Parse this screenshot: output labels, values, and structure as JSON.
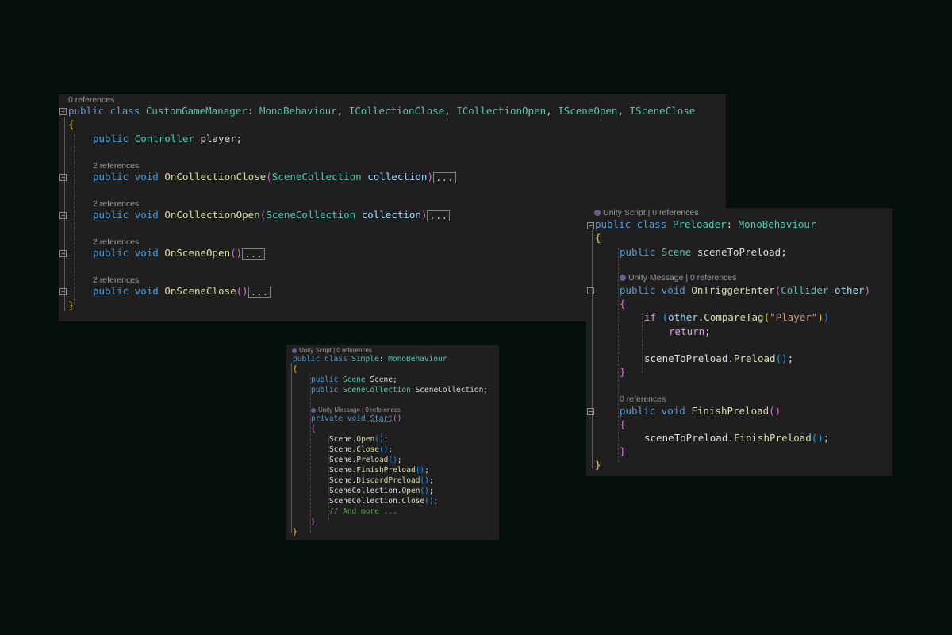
{
  "panel1": {
    "class_refs": "0 references",
    "class_kw": "public class ",
    "class_name": "CustomGameManager",
    "class_colon": ": ",
    "base_mono": "MonoBehaviour",
    "comma": ", ",
    "iface1": "ICollectionClose",
    "iface2": "ICollectionOpen",
    "iface3": "ISceneOpen",
    "iface4": "ISceneClose",
    "open_brace": "{",
    "close_brace": "}",
    "field_kw": "public ",
    "field_type": "Controller",
    "field_name": " player;",
    "methods": [
      {
        "refs": "2 references",
        "kw": "public void ",
        "name": "OnCollectionClose",
        "ptype": "SceneCollection",
        "pname": "collection",
        "ellipsis": "..."
      },
      {
        "refs": "2 references",
        "kw": "public void ",
        "name": "OnCollectionOpen",
        "ptype": "SceneCollection",
        "pname": "collection",
        "ellipsis": "..."
      },
      {
        "refs": "2 references",
        "kw": "public void ",
        "name": "OnSceneOpen",
        "ptype": "",
        "pname": "",
        "ellipsis": "..."
      },
      {
        "refs": "2 references",
        "kw": "public void ",
        "name": "OnSceneClose",
        "ptype": "",
        "pname": "",
        "ellipsis": "..."
      }
    ]
  },
  "panel2": {
    "class_refs": "Unity Script | 0 references",
    "class_kw": "public class ",
    "class_name": "Preloader",
    "class_colon": ": ",
    "base": "MonoBehaviour",
    "field_kw": "public ",
    "field_type": "Scene",
    "field_name": " sceneToPreload;",
    "m1_refs": "Unity Message | 0 references",
    "m1_kw": "public void ",
    "m1_name": "OnTriggerEnter",
    "m1_ptype": "Collider",
    "m1_pname": "other",
    "if_kw": "if",
    "if_obj": "other",
    "if_call": "CompareTag",
    "if_str": "\"Player\"",
    "return_kw": "return",
    "call1_obj": "sceneToPreload",
    "call1_fn": "Preload",
    "m2_refs": "0 references",
    "m2_kw": "public void ",
    "m2_name": "FinishPreload",
    "call2_obj": "sceneToPreload",
    "call2_fn": "FinishPreload"
  },
  "panel3": {
    "class_refs": "Unity Script | 0 references",
    "class_kw": "public class ",
    "class_name": "Simple",
    "class_colon": ": ",
    "base": "MonoBehaviour",
    "f1_kw": "public ",
    "f1_type": "Scene",
    "f1_name": " Scene;",
    "f2_kw": "public ",
    "f2_type": "SceneCollection",
    "f2_name": " SceneCollection;",
    "m_refs": "Unity Message | 0 references",
    "m_kw": "private void ",
    "m_name": "Start",
    "calls": [
      {
        "obj": "Scene",
        "fn": "Open"
      },
      {
        "obj": "Scene",
        "fn": "Close"
      },
      {
        "obj": "Scene",
        "fn": "Preload"
      },
      {
        "obj": "Scene",
        "fn": "FinishPreload"
      },
      {
        "obj": "Scene",
        "fn": "DiscardPreload"
      },
      {
        "obj": "SceneCollection",
        "fn": "Open"
      },
      {
        "obj": "SceneCollection",
        "fn": "Close"
      }
    ],
    "comment": "// And more ..."
  }
}
